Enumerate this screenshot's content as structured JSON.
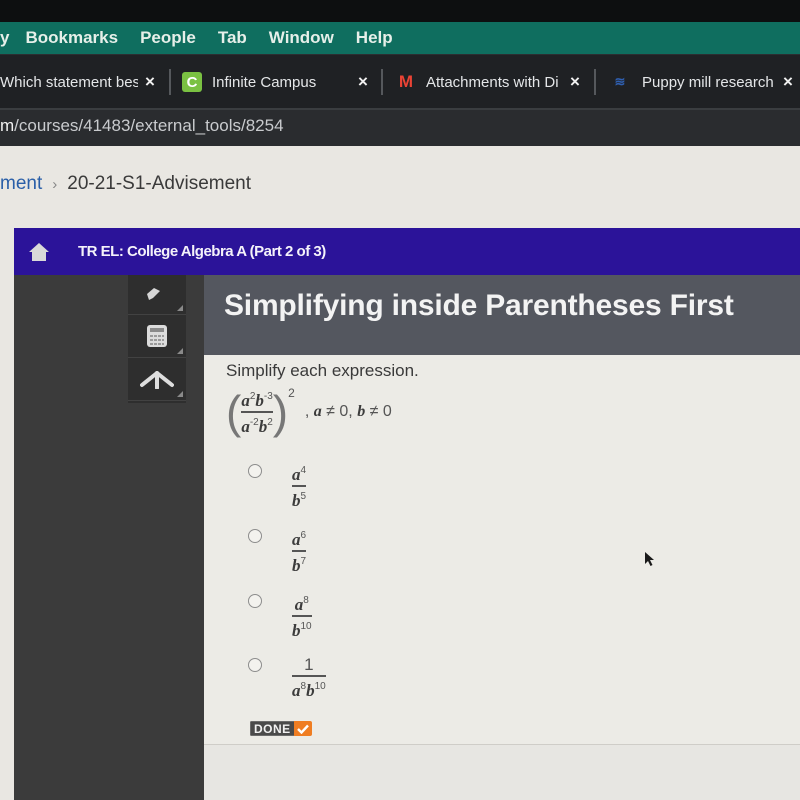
{
  "menubar": {
    "items": [
      "y",
      "Bookmarks",
      "People",
      "Tab",
      "Window",
      "Help"
    ]
  },
  "tabs": [
    {
      "title": "Which statement bes",
      "favicon": "none",
      "close": "×"
    },
    {
      "title": "Infinite Campus",
      "favicon": "C",
      "close": "×"
    },
    {
      "title": "Attachments with Di",
      "favicon": "M",
      "close": "×"
    },
    {
      "title": "Puppy mill research",
      "favicon": "wave-logo",
      "close": "×"
    }
  ],
  "address": {
    "prefix": "m",
    "path": "/courses/41483/external_tools/8254"
  },
  "breadcrumb": {
    "parent": "ment",
    "separator": "›",
    "current": "20-21-S1-Advisement"
  },
  "app": {
    "course_title": "TR EL: College Algebra A (Part 2 of 3)",
    "tools": [
      "pencil-icon",
      "calculator-icon",
      "collapse-up-icon"
    ],
    "lesson_title": "Simplifying inside Parentheses First",
    "prompt": "Simplify each expression.",
    "expression": {
      "numerator": {
        "a_exp": "2",
        "b_exp": "-3"
      },
      "denominator": {
        "a_exp": "-2",
        "b_exp": "2"
      },
      "outer_exp": "2",
      "condition": {
        "a": "a",
        "a_ne": "≠ 0,",
        "b": "b",
        "b_ne": "≠ 0"
      }
    },
    "choices": [
      {
        "num": "a",
        "num_exp": "4",
        "den": "b",
        "den_exp": "5",
        "selected": false
      },
      {
        "num": "a",
        "num_exp": "6",
        "den": "b",
        "den_exp": "7",
        "selected": false
      },
      {
        "num": "a",
        "num_exp": "8",
        "den": "b",
        "den_exp": "10",
        "selected": false
      },
      {
        "num": "1",
        "den_a": "a",
        "den_a_exp": "8",
        "den_b": "b",
        "den_b_exp": "10",
        "selected": false
      }
    ],
    "done_label": "DONE",
    "colors": {
      "header": "#2b1399",
      "done_check": "#ef7d22",
      "lesson_head": "#54575f"
    }
  }
}
